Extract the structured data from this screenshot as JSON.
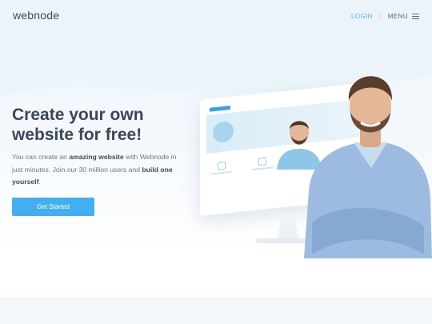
{
  "header": {
    "logo": "webnode",
    "login_label": "LOGIN",
    "menu_label": "MENU"
  },
  "hero": {
    "title": "Create your own website for free!",
    "lead_1": "You can create an ",
    "lead_bold_1": "amazing website",
    "lead_2": " with Webnode in just minutes. Join our 30 million users and ",
    "lead_bold_2": "build one yourself",
    "lead_3": ".",
    "cta_label": "Get Started"
  },
  "colors": {
    "accent": "#43aef0",
    "login": "#56b2e6",
    "heading": "#3a4757"
  },
  "icons": [
    "hamburger-menu-icon",
    "dental-service-icon"
  ]
}
